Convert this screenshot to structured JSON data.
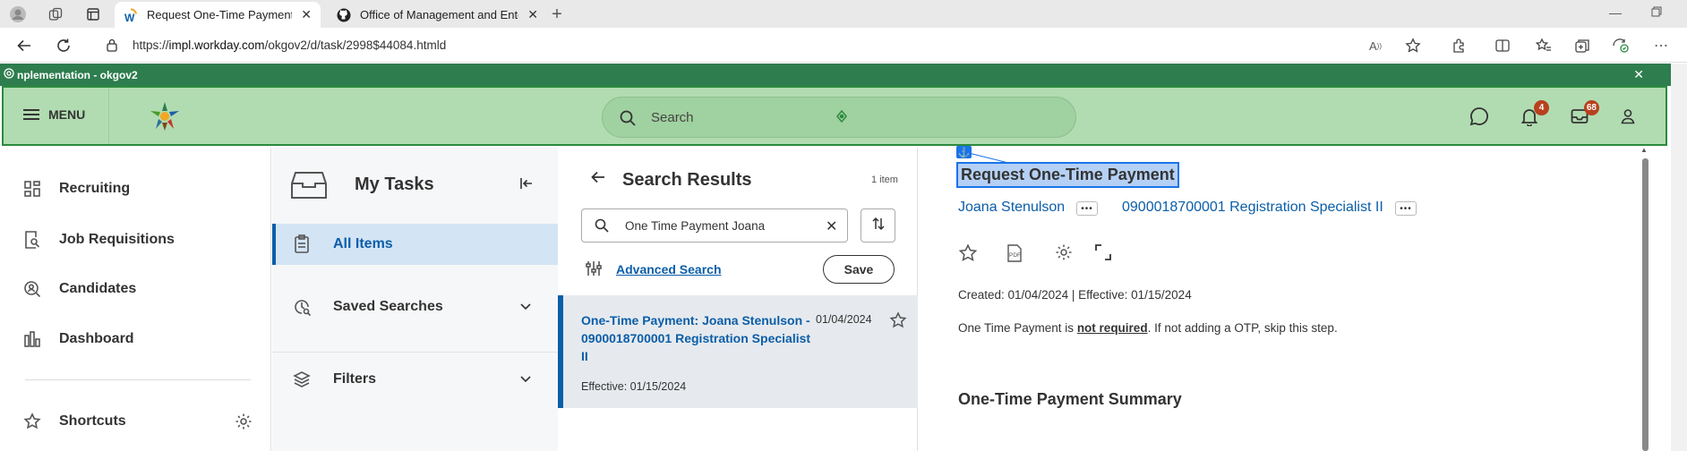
{
  "browser": {
    "tabs": [
      {
        "label": "Request One-Time Payment - Wo",
        "favicon": "workday-w-icon",
        "active": true
      },
      {
        "label": "Office of Management and Enter",
        "favicon": "github-icon",
        "active": false
      }
    ],
    "url_prefix": "https://",
    "url_host": "impl.workday.com",
    "url_path": "/okgov2/d/task/2998$44084.htmld"
  },
  "banner": {
    "text": "nplementation - okgov2",
    "close": "✕"
  },
  "header": {
    "menu_label": "MENU",
    "search_placeholder": "Search",
    "notifications_count": "4",
    "inbox_count": "68"
  },
  "leftnav": {
    "items": [
      {
        "label": "Recruiting",
        "icon": "grid-icon"
      },
      {
        "label": "Job Requisitions",
        "icon": "document-search-icon"
      },
      {
        "label": "Candidates",
        "icon": "candidate-search-icon"
      },
      {
        "label": "Dashboard",
        "icon": "bar-chart-icon"
      }
    ],
    "shortcuts_label": "Shortcuts"
  },
  "tasks": {
    "title": "My Tasks",
    "items": [
      {
        "label": "All Items",
        "icon": "clipboard-icon",
        "active": true
      },
      {
        "label": "Saved Searches",
        "icon": "clock-search-icon",
        "active": false
      },
      {
        "label": "Filters",
        "icon": "layers-icon",
        "active": false
      }
    ]
  },
  "results": {
    "title": "Search Results",
    "count": "1 item",
    "search_value": "One Time Payment Joana",
    "clear": "✕",
    "advanced_search": "Advanced Search",
    "save_label": "Save",
    "card": {
      "title": "One-Time Payment: Joana Stenulson - 0900018700001 Registration Specialist II",
      "date": "01/04/2024",
      "effective": "Effective: 01/15/2024"
    }
  },
  "detail": {
    "title": "Request One-Time Payment",
    "person": "Joana Stenulson",
    "position": "0900018700001 Registration Specialist II",
    "created": "Created: 01/04/2024 | Effective: 01/15/2024",
    "note_before": "One Time Payment is ",
    "note_emph": "not required",
    "note_after": ". If not adding a OTP, skip this step.",
    "section_title": "One-Time Payment Summary",
    "pdf_label": "PDF"
  },
  "colors": {
    "header_bg": "#b1dcb1",
    "banner_bg": "#2e7d4f",
    "link_blue": "#0b5ea8",
    "badge": "#b8401e"
  }
}
